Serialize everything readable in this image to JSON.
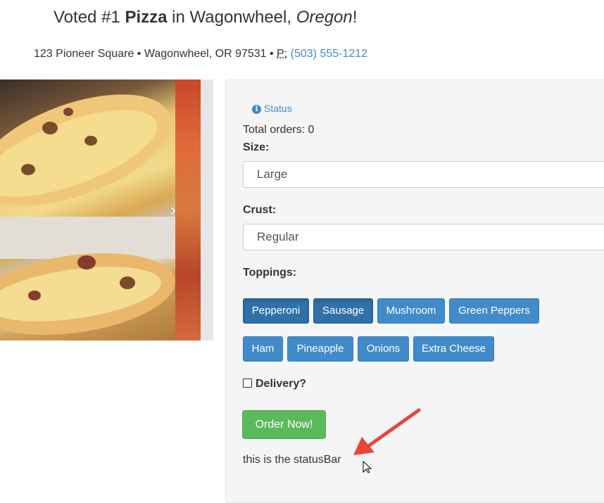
{
  "header": {
    "headline_pre": "Voted #1 ",
    "headline_bold": "Pizza",
    "headline_mid": " in Wagonwheel, ",
    "headline_italic": "Oregon",
    "headline_post": "!",
    "address": "123 Pioneer Square • Wagonwheel, OR 97531 • ",
    "phone_abbr": "P:",
    "phone": "(503) 555-1212"
  },
  "order_form": {
    "status_link": "Status",
    "status_icon": "info-icon",
    "total_orders": "Total orders: 0",
    "size_label": "Size:",
    "size_value": "Large",
    "crust_label": "Crust:",
    "crust_value": "Regular",
    "toppings_label": "Toppings:",
    "toppings": [
      {
        "label": "Pepperoni",
        "active": true
      },
      {
        "label": "Sausage",
        "active": true
      },
      {
        "label": "Mushroom",
        "active": false
      },
      {
        "label": "Green Peppers",
        "active": false
      },
      {
        "label": "Ham",
        "active": false
      },
      {
        "label": "Pineapple",
        "active": false
      },
      {
        "label": "Onions",
        "active": false
      },
      {
        "label": "Extra Cheese",
        "active": false
      }
    ],
    "delivery_label": "Delivery?",
    "delivery_checked": false,
    "order_button": "Order Now!",
    "status_bar": "this is the statusBar"
  },
  "colors": {
    "primary": "#428bca",
    "primary_active": "#3071a9",
    "success": "#5cb85c",
    "annotation_arrow": "#e8463b"
  }
}
